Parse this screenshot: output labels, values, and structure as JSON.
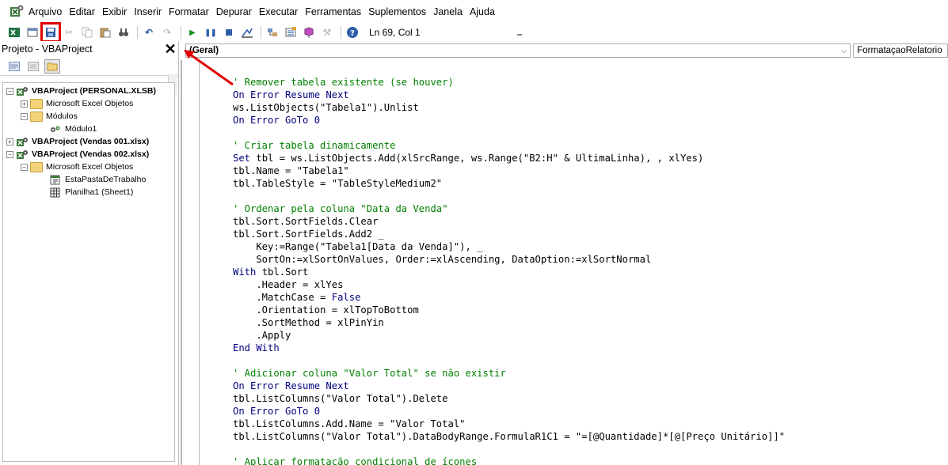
{
  "menubar": {
    "icon": "vba-editor-icon",
    "items": [
      {
        "label": "Arquivo"
      },
      {
        "label": "Editar"
      },
      {
        "label": "Exibir"
      },
      {
        "label": "Inserir"
      },
      {
        "label": "Formatar"
      },
      {
        "label": "Depurar"
      },
      {
        "label": "Executar"
      },
      {
        "label": "Ferramentas"
      },
      {
        "label": "Suplementos"
      },
      {
        "label": "Janela"
      },
      {
        "label": "Ajuda"
      }
    ]
  },
  "toolbar": {
    "cursor_position": "Ln 69, Col 1",
    "highlight_color": "#e00000"
  },
  "project_panel": {
    "title": "Projeto - VBAProject",
    "close_glyph": "✕",
    "tree": [
      {
        "label": "VBAProject (PERSONAL.XLSB)",
        "bold": true
      },
      {
        "label": "Microsoft Excel Objetos",
        "bold": false
      },
      {
        "label": "Módulos",
        "bold": false
      },
      {
        "label": "Módulo1",
        "bold": false
      },
      {
        "label": "VBAProject (Vendas 001.xlsx)",
        "bold": true
      },
      {
        "label": "VBAProject (Vendas 002.xlsx)",
        "bold": true
      },
      {
        "label": "Microsoft Excel Objetos",
        "bold": false
      },
      {
        "label": "EstaPastaDeTrabalho",
        "bold": false
      },
      {
        "label": "Planilha1 (Sheet1)",
        "bold": false
      }
    ]
  },
  "code_window": {
    "object_combo": "(Geral)",
    "procedure_combo": "FormataçaoRelatorio",
    "keyword_color": "#00007f",
    "comment_color": "#008000",
    "lines": [
      [
        {
          "t": "cm",
          "v": "' Remover tabela existente (se houver)"
        }
      ],
      [
        {
          "t": "kw",
          "v": "On Error Resume Next"
        }
      ],
      [
        {
          "t": "tx",
          "v": "ws.ListObjects(\"Tabela1\").Unlist"
        }
      ],
      [
        {
          "t": "kw",
          "v": "On Error GoTo 0"
        }
      ],
      [
        {
          "t": "tx",
          "v": ""
        }
      ],
      [
        {
          "t": "cm",
          "v": "' Criar tabela dinamicamente"
        }
      ],
      [
        {
          "t": "kw",
          "v": "Set"
        },
        {
          "t": "tx",
          "v": " tbl = ws.ListObjects.Add(xlSrcRange, ws.Range(\"B2:H\" & UltimaLinha), , xlYes)"
        }
      ],
      [
        {
          "t": "tx",
          "v": "tbl.Name = \"Tabela1\""
        }
      ],
      [
        {
          "t": "tx",
          "v": "tbl.TableStyle = \"TableStyleMedium2\""
        }
      ],
      [
        {
          "t": "tx",
          "v": ""
        }
      ],
      [
        {
          "t": "cm",
          "v": "' Ordenar pela coluna \"Data da Venda\""
        }
      ],
      [
        {
          "t": "tx",
          "v": "tbl.Sort.SortFields.Clear"
        }
      ],
      [
        {
          "t": "tx",
          "v": "tbl.Sort.SortFields.Add2 _"
        }
      ],
      [
        {
          "t": "tx",
          "v": "    Key:=Range(\"Tabela1[Data da Venda]\"), _"
        }
      ],
      [
        {
          "t": "tx",
          "v": "    SortOn:=xlSortOnValues, Order:=xlAscending, DataOption:=xlSortNormal"
        }
      ],
      [
        {
          "t": "kw",
          "v": "With"
        },
        {
          "t": "tx",
          "v": " tbl.Sort"
        }
      ],
      [
        {
          "t": "tx",
          "v": "    .Header = xlYes"
        }
      ],
      [
        {
          "t": "tx",
          "v": "    .MatchCase = "
        },
        {
          "t": "kw",
          "v": "False"
        }
      ],
      [
        {
          "t": "tx",
          "v": "    .Orientation = xlTopToBottom"
        }
      ],
      [
        {
          "t": "tx",
          "v": "    .SortMethod = xlPinYin"
        }
      ],
      [
        {
          "t": "tx",
          "v": "    .Apply"
        }
      ],
      [
        {
          "t": "kw",
          "v": "End With"
        }
      ],
      [
        {
          "t": "tx",
          "v": ""
        }
      ],
      [
        {
          "t": "cm",
          "v": "' Adicionar coluna \"Valor Total\" se não existir"
        }
      ],
      [
        {
          "t": "kw",
          "v": "On Error Resume Next"
        }
      ],
      [
        {
          "t": "tx",
          "v": "tbl.ListColumns(\"Valor Total\").Delete"
        }
      ],
      [
        {
          "t": "kw",
          "v": "On Error GoTo 0"
        }
      ],
      [
        {
          "t": "tx",
          "v": "tbl.ListColumns.Add.Name = \"Valor Total\""
        }
      ],
      [
        {
          "t": "tx",
          "v": "tbl.ListColumns(\"Valor Total\").DataBodyRange.FormulaR1C1 = \"=[@Quantidade]*[@[Preço Unitário]]\""
        }
      ],
      [
        {
          "t": "tx",
          "v": ""
        }
      ],
      [
        {
          "t": "cm",
          "v": "' Aplicar formatação condicional de ícones"
        }
      ]
    ]
  }
}
